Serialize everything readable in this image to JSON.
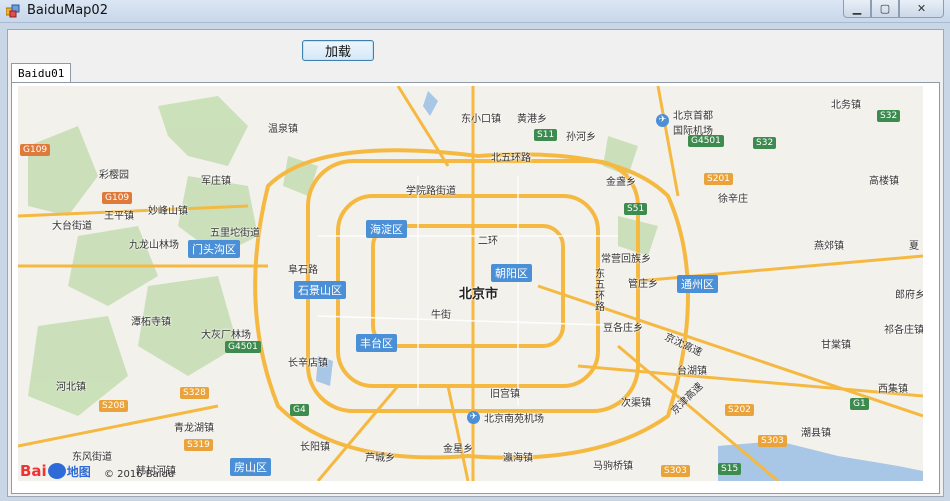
{
  "window": {
    "title": "BaiduMap02"
  },
  "toolbar": {
    "load_label": "加载"
  },
  "tabs": [
    {
      "label": "Baidu01"
    }
  ],
  "map": {
    "city": "北京市",
    "districts": [
      "海淀区",
      "朝阳区",
      "石景山区",
      "丰台区",
      "门头沟区",
      "通州区",
      "房山区"
    ],
    "labels": [
      "温泉镇",
      "黄港乡",
      "东小口镇",
      "孙河乡",
      "北务镇",
      "北京首都国际机场",
      "北五环路",
      "学院路街道",
      "彩樱园",
      "军庄镇",
      "金盏乡",
      "高楼镇",
      "大台街道",
      "王平镇",
      "妙峰山镇",
      "五里坨街道",
      "徐辛庄",
      "九龙山林场",
      "二环",
      "常营回族乡",
      "燕郊镇",
      "阜石路",
      "东五环路",
      "管庄乡",
      "潭柘寺镇",
      "大灰厂林场",
      "牛街",
      "郎府乡",
      "豆各庄乡",
      "祁各庄镇",
      "长辛店镇",
      "甘棠镇",
      "台湖镇",
      "河北镇",
      "旧宫镇",
      "西集镇",
      "次渠镇",
      "青龙湖镇",
      "北京南苑机场",
      "潮县镇",
      "东风街道",
      "长阳镇",
      "芦城乡",
      "金星乡",
      "瀛海镇",
      "马驹桥镇",
      "韩村河镇",
      "京沈高速",
      "京津高速",
      "夏"
    ],
    "shields": [
      "G109",
      "G109",
      "S11",
      "G4501",
      "S32",
      "S32",
      "S201",
      "S51",
      "G4501",
      "G4",
      "S328",
      "S208",
      "S319",
      "S202",
      "G1",
      "S303",
      "S303",
      "S15"
    ],
    "airport_icon": "airport-icon",
    "copyright": "© 2016 Baidu",
    "logo_text": [
      "Bai",
      "地图"
    ]
  }
}
